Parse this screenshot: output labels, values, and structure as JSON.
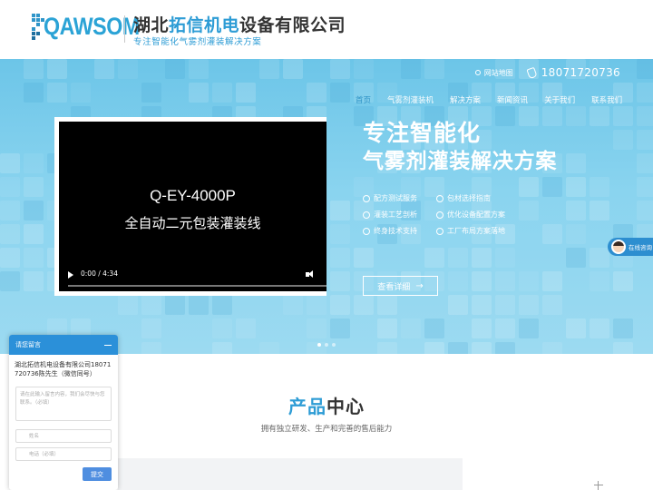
{
  "header": {
    "logo_text": "QAWSOM",
    "company_name_part1": "湖北",
    "company_name_accent": "拓信机电",
    "company_name_part2": "设备有限公司",
    "slogan": "专注智能化气雾剂灌装解决方案"
  },
  "topbar": {
    "sitemap_label": "网站地图",
    "phone": "18071720736"
  },
  "nav": {
    "items": [
      {
        "label": "首页",
        "active": true
      },
      {
        "label": "气雾剂灌装机"
      },
      {
        "label": "解决方案"
      },
      {
        "label": "新闻资讯"
      },
      {
        "label": "关于我们"
      },
      {
        "label": "联系我们"
      }
    ]
  },
  "video": {
    "title_line1": "Q-EY-4000P",
    "title_line2": "全自动二元包装灌装线",
    "time": "0:00 / 4:34"
  },
  "hero": {
    "headline_line1": "专注智能化",
    "headline_line2": "气雾剂灌装解决方案",
    "features": [
      "配方测试服务",
      "包材选择指南",
      "灌装工艺剖析",
      "优化设备配置方案",
      "终身技术支持",
      "工厂布局方案落地"
    ],
    "cta_label": "查看详细",
    "cta_arrow": "→"
  },
  "online_service": {
    "label": "在线咨询"
  },
  "products": {
    "title_accent": "产品",
    "title_rest": "中心",
    "subtitle": "拥有独立研发、生产和完善的售后能力"
  },
  "message_panel": {
    "title": "请您留言",
    "info": "湖北拓信机电设备有限公司18071720736陈先生（微信同号）",
    "content_placeholder": "请在此输入留言内容，我们会尽快与您联系。（必填）",
    "name_placeholder": "姓名",
    "phone_placeholder": "电话（必填）",
    "submit_label": "提交"
  },
  "colors": {
    "accent": "#2d9cd5",
    "banner_top": "#6cc5e8",
    "panel_header": "#2b90d9",
    "submit_button": "#4f8ee0"
  }
}
